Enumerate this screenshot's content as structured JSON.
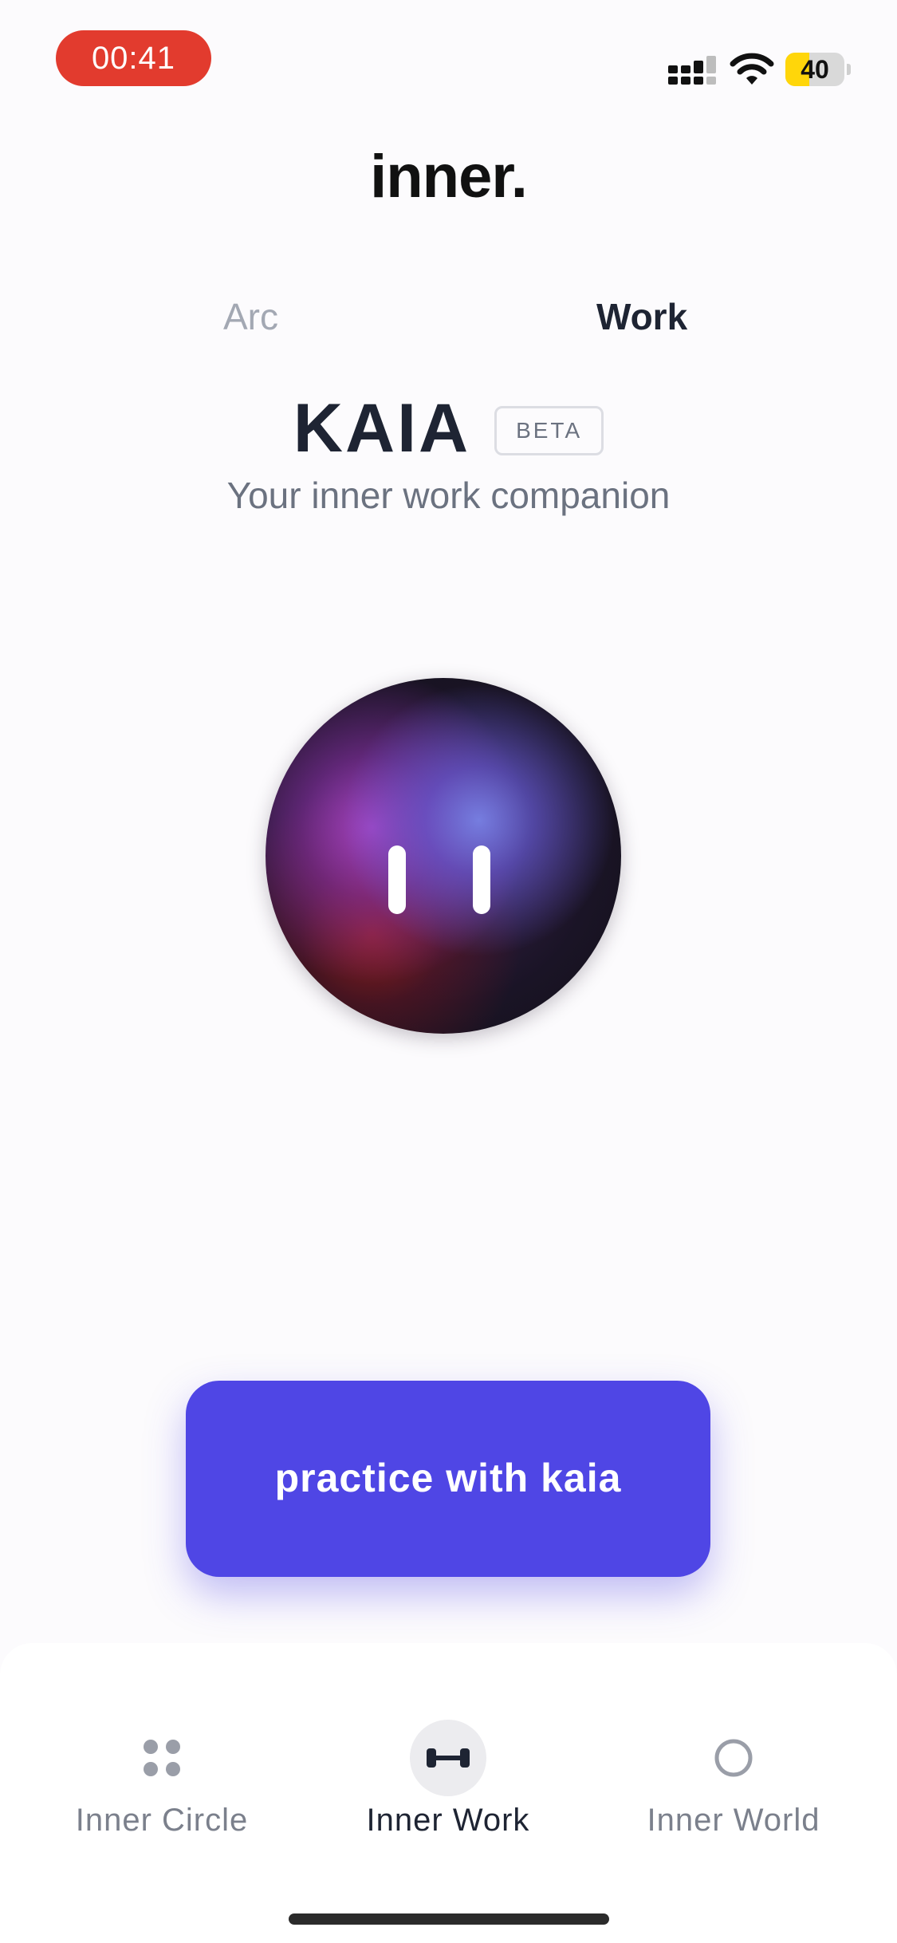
{
  "status_bar": {
    "time": "00:41",
    "battery_level": 40,
    "battery_label": "40",
    "icons": [
      "signal-icon",
      "wifi-icon",
      "battery-icon"
    ]
  },
  "header": {
    "title": "inner."
  },
  "tabs": [
    {
      "label": "Arc",
      "active": false
    },
    {
      "label": "Work",
      "active": true
    }
  ],
  "companion": {
    "name": "KAIA",
    "badge": "BETA",
    "subtitle": "Your inner work companion",
    "orb_icon": "pause-icon"
  },
  "primary_action": {
    "label": "practice with kaia",
    "color": "#4f46e5"
  },
  "bottom_nav": {
    "items": [
      {
        "label": "Inner Circle",
        "icon": "dots-grid-icon",
        "active": false
      },
      {
        "label": "Inner Work",
        "icon": "dumbbell-icon",
        "active": true
      },
      {
        "label": "Inner World",
        "icon": "circle-icon",
        "active": false
      }
    ]
  },
  "colors": {
    "recording": "#e23b2e",
    "battery": "#ffd60a",
    "accent": "#4f46e5",
    "text_primary": "#1e2433",
    "text_muted": "#6b7280"
  }
}
